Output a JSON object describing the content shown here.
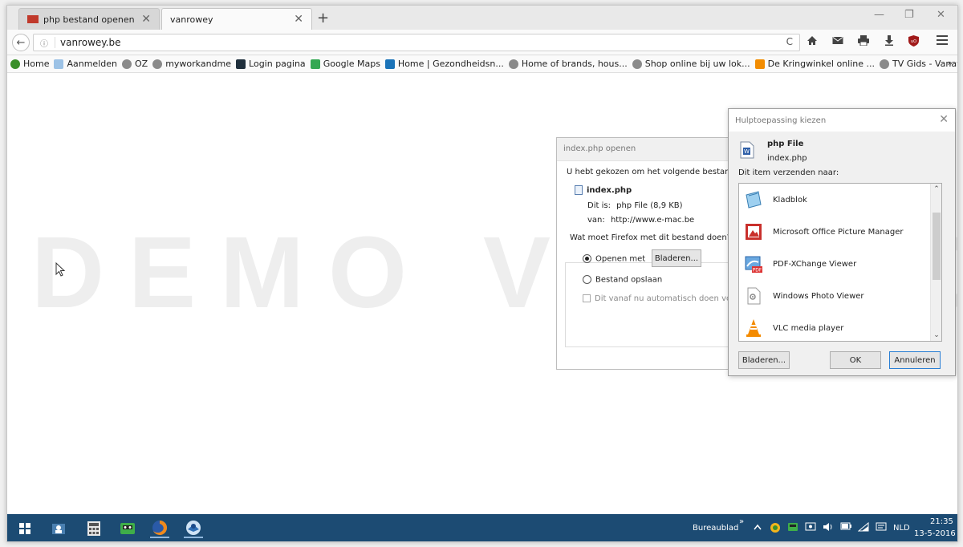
{
  "browser": {
    "tabs": [
      {
        "label": "php bestand openen - Wi...",
        "close": "✕"
      },
      {
        "label": "vanrowey",
        "close": "✕"
      }
    ],
    "new_tab": "+",
    "window_controls": {
      "minimize": "—",
      "maximize": "❐",
      "close": "✕"
    },
    "url": "vanrowey.be",
    "url_info_icon": "ⓘ",
    "reload_icon": "C",
    "toolbar_icons": [
      "home-icon",
      "mail-icon",
      "print-icon",
      "download-icon",
      "ublock-icon",
      "menu-icon"
    ]
  },
  "bookmarks": [
    {
      "label": "Home",
      "icon_color": "#3a8f2a"
    },
    {
      "label": "Aanmelden",
      "icon_color": "#9cc2e6"
    },
    {
      "label": "OZ",
      "icon_color": "#8a8a8a"
    },
    {
      "label": "myworkandme",
      "icon_color": "#8a8a8a"
    },
    {
      "label": "Login pagina",
      "icon_color": "#20303d"
    },
    {
      "label": "Google Maps",
      "icon_color": "#34a853"
    },
    {
      "label": "Home | Gezondheidsn...",
      "icon_color": "#1a73b8"
    },
    {
      "label": "Home of brands, hous...",
      "icon_color": "#8a8a8a"
    },
    {
      "label": "Shop online bij uw lok...",
      "icon_color": "#8a8a8a"
    },
    {
      "label": "De Kringwinkel online ...",
      "icon_color": "#f28c00"
    },
    {
      "label": "TV Gids - Vanavond en...",
      "icon_color": "#8a8a8a"
    }
  ],
  "bookmarks_more": "»",
  "watermark": "DEMO VERSION",
  "open_dialog": {
    "title": "index.php openen",
    "intro": "U hebt gekozen om het volgende bestand te",
    "file_name": "index.php",
    "type_label": "Dit is:",
    "type_value": "php File (8,9 KB)",
    "from_label": "van:",
    "from_value": "http://www.e-mac.be",
    "question": "Wat moet Firefox met dit bestand doen?",
    "open_with": "Openen met",
    "browse": "Bladeren...",
    "save_file": "Bestand opslaan",
    "auto_do": "Dit vanaf nu automatisch doen voor"
  },
  "helper_dialog": {
    "title": "Hulptoepassing kiezen",
    "close": "✕",
    "file_type": "php File",
    "file_name": "index.php",
    "send_to": "Dit item verzenden naar:",
    "apps": [
      {
        "label": "Kladblok",
        "icon": "notepad-icon"
      },
      {
        "label": "Microsoft Office Picture Manager",
        "icon": "picture-manager-icon"
      },
      {
        "label": "PDF-XChange Viewer",
        "icon": "pdf-xchange-icon"
      },
      {
        "label": "Windows Photo Viewer",
        "icon": "photo-viewer-icon"
      },
      {
        "label": "VLC media player",
        "icon": "vlc-icon"
      }
    ],
    "browse": "Bladeren...",
    "ok": "OK",
    "cancel": "Annuleren"
  },
  "taskbar": {
    "desktop_label": "Bureaublad",
    "chevron": "»",
    "language": "NLD",
    "time": "21:35",
    "date": "13-5-2016"
  }
}
